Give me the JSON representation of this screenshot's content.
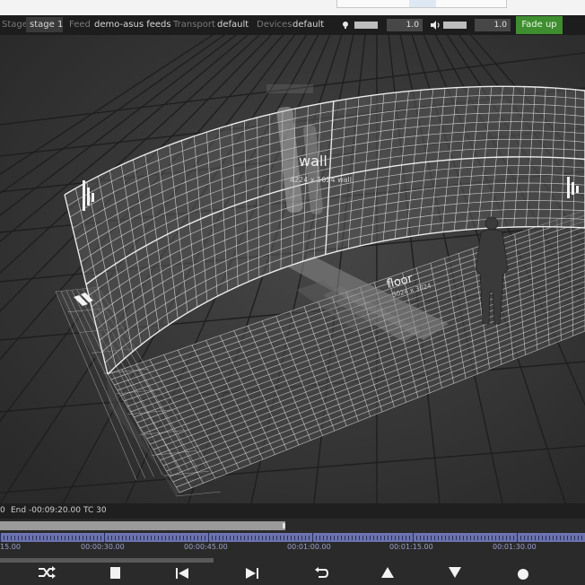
{
  "header": {
    "stage_label": "Stage",
    "stage_value": "stage 1",
    "feed_label": "Feed",
    "feed_value": "demo-asus feeds",
    "transport_label": "Transport",
    "transport_value": "default",
    "devices_label": "Devices",
    "devices_value": "default",
    "brightness_value": "1.0",
    "volume_value": "1.0",
    "fade_button": "Fade up"
  },
  "viewport": {
    "wall_label": "wall",
    "wall_dims": "4224 x 1024 wall",
    "floor_label": "floor",
    "floor_dims": "3024 x 3024"
  },
  "timeline": {
    "start_fragment": "0",
    "end_text": "End -00:09:20.00",
    "tc_text": "TC 30",
    "timecodes": [
      "15.00",
      "00:00:30.00",
      "00:00:45.00",
      "00:01:00.00",
      "00:01:15.00",
      "00:01:30.00"
    ]
  },
  "controls": [
    {
      "name": "shuffle-icon"
    },
    {
      "name": "stop-icon"
    },
    {
      "name": "skip-back-icon"
    },
    {
      "name": "skip-forward-icon"
    },
    {
      "name": "loop-icon"
    },
    {
      "name": "up-arrow-icon"
    },
    {
      "name": "down-arrow-icon"
    },
    {
      "name": "record-icon"
    }
  ],
  "colors": {
    "accent_green": "#3e8d2f",
    "timeline_purple": "#6c73b0",
    "background": "#2b2b2b"
  }
}
